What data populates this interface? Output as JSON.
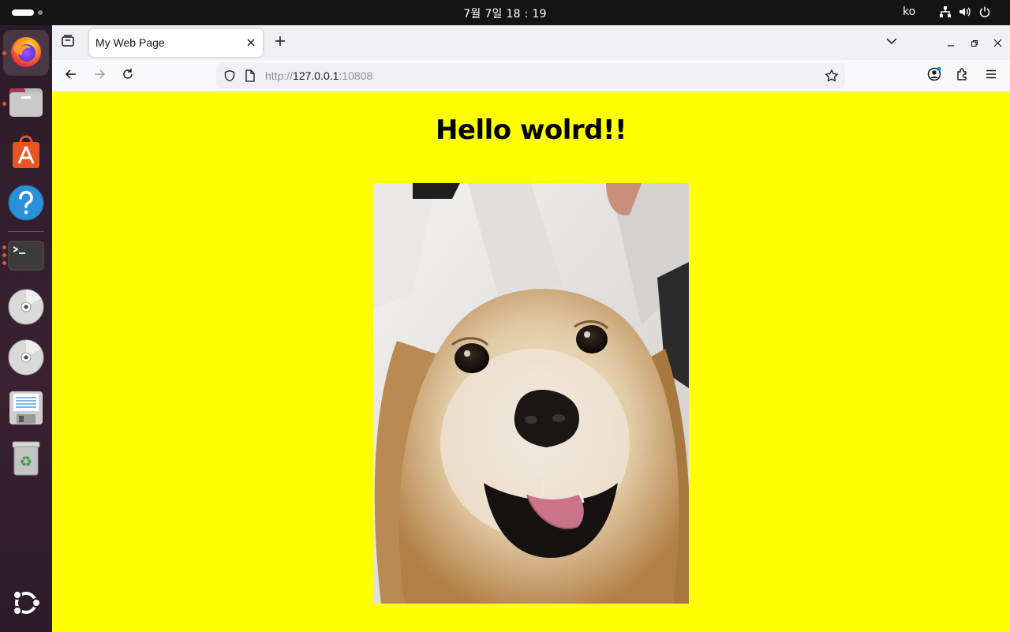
{
  "system": {
    "clock": "7월 7일  18 : 19",
    "input_language": "ko"
  },
  "dock": {
    "apps": [
      {
        "name": "Firefox",
        "icon": "firefox-icon"
      },
      {
        "name": "Files",
        "icon": "files-icon"
      },
      {
        "name": "App Center",
        "icon": "app-center-icon"
      },
      {
        "name": "Help",
        "icon": "help-icon"
      },
      {
        "name": "Terminal",
        "icon": "terminal-icon"
      },
      {
        "name": "Disc 1",
        "icon": "disc-icon"
      },
      {
        "name": "Disc 2",
        "icon": "disc-icon"
      },
      {
        "name": "Floppy",
        "icon": "floppy-icon"
      },
      {
        "name": "Trash",
        "icon": "trash-icon"
      },
      {
        "name": "Show Apps",
        "icon": "ubuntu-logo-icon"
      }
    ]
  },
  "browser": {
    "tab_title": "My Web Page",
    "url_scheme": "http://",
    "url_host": "127.0.0.1",
    "url_port": ":10808"
  },
  "page": {
    "heading": "Hello wolrd!!",
    "image_subject": "golden retriever photo"
  },
  "colors": {
    "page_background": "#ffff00",
    "accent": "#e95420"
  }
}
